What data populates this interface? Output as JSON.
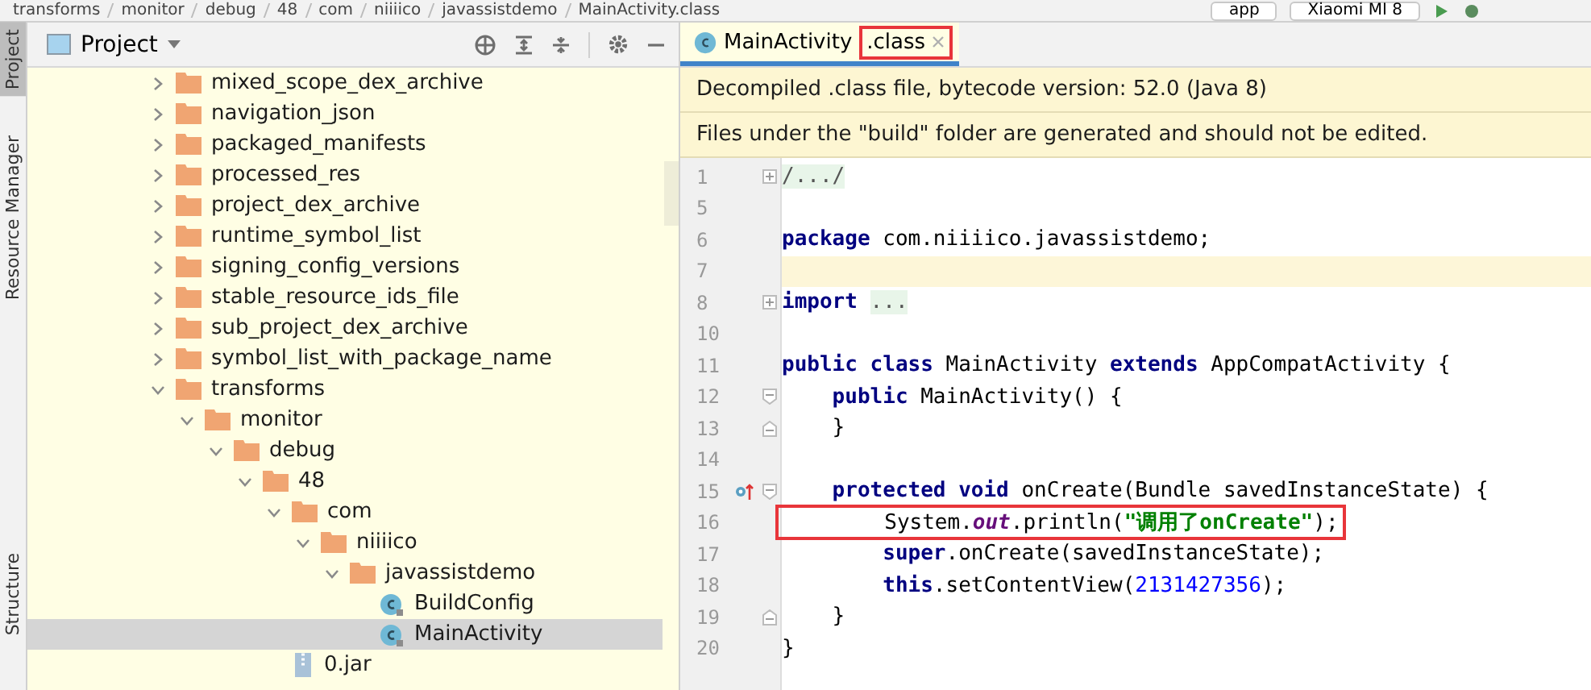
{
  "breadcrumbs": [
    "transforms",
    "monitor",
    "debug",
    "48",
    "com",
    "niiiico",
    "javassistdemo",
    "MainActivity.class"
  ],
  "run_config": {
    "module": "app",
    "device": "Xiaomi MI 8"
  },
  "tool_strip": [
    {
      "label": "Project",
      "selected": true
    },
    {
      "label": "Resource Manager",
      "selected": false
    },
    {
      "label": "Structure",
      "selected": false
    }
  ],
  "project_panel": {
    "title": "Project",
    "tree": [
      {
        "name": "mixed_scope_dex_archive",
        "kind": "folder",
        "expanded": false,
        "selected": false
      },
      {
        "name": "navigation_json",
        "kind": "folder",
        "expanded": false,
        "selected": false
      },
      {
        "name": "packaged_manifests",
        "kind": "folder",
        "expanded": false,
        "selected": false
      },
      {
        "name": "processed_res",
        "kind": "folder",
        "expanded": false,
        "selected": false
      },
      {
        "name": "project_dex_archive",
        "kind": "folder",
        "expanded": false,
        "selected": false
      },
      {
        "name": "runtime_symbol_list",
        "kind": "folder",
        "expanded": false,
        "selected": false
      },
      {
        "name": "signing_config_versions",
        "kind": "folder",
        "expanded": false,
        "selected": false
      },
      {
        "name": "stable_resource_ids_file",
        "kind": "folder",
        "expanded": false,
        "selected": false
      },
      {
        "name": "sub_project_dex_archive",
        "kind": "folder",
        "expanded": false,
        "selected": false
      },
      {
        "name": "symbol_list_with_package_name",
        "kind": "folder",
        "expanded": false,
        "selected": false
      },
      {
        "name": "transforms",
        "kind": "folder",
        "expanded": true,
        "selected": false,
        "children": [
          {
            "name": "monitor",
            "kind": "folder",
            "expanded": true,
            "selected": false,
            "children": [
              {
                "name": "debug",
                "kind": "folder",
                "expanded": true,
                "selected": false,
                "children": [
                  {
                    "name": "48",
                    "kind": "folder",
                    "expanded": true,
                    "selected": false,
                    "children": [
                      {
                        "name": "com",
                        "kind": "folder",
                        "expanded": true,
                        "selected": false,
                        "children": [
                          {
                            "name": "niiiico",
                            "kind": "folder",
                            "expanded": true,
                            "selected": false,
                            "children": [
                              {
                                "name": "javassistdemo",
                                "kind": "folder",
                                "expanded": true,
                                "selected": false,
                                "children": [
                                  {
                                    "name": "BuildConfig",
                                    "kind": "class",
                                    "selected": false
                                  },
                                  {
                                    "name": "MainActivity",
                                    "kind": "class",
                                    "selected": true
                                  }
                                ]
                              }
                            ]
                          }
                        ]
                      },
                      {
                        "name": "0.jar",
                        "kind": "jar",
                        "selected": false
                      }
                    ]
                  }
                ]
              }
            ]
          }
        ]
      }
    ]
  },
  "editor": {
    "tabs": [
      {
        "name": "MainActivity",
        "extension": ".class",
        "selected": true,
        "highlighted": true
      }
    ],
    "banners": [
      "Decompiled .class file, bytecode version: 52.0 (Java 8)",
      "Files under the \"build\" folder are generated and should not be edited."
    ],
    "lines": [
      {
        "number": "1",
        "marker": {
          "kind": "collapsed"
        },
        "current": false,
        "highlighted": false,
        "tokens": [
          {
            "kind": "folded",
            "text": "/.../"
          }
        ]
      },
      {
        "number": "5",
        "current": false
      },
      {
        "number": "6",
        "current": false,
        "highlighted": false,
        "tokens": [
          {
            "kind": "kw",
            "text": "package"
          },
          {
            "kind": "plain",
            "text": " com.niiiico.javassistdemo;"
          }
        ]
      },
      {
        "number": "7",
        "current": true
      },
      {
        "number": "8",
        "marker": {
          "kind": "collapsed"
        },
        "current": false,
        "highlighted": false,
        "tokens": [
          {
            "kind": "kw",
            "text": "import "
          },
          {
            "kind": "folded",
            "text": "..."
          }
        ]
      },
      {
        "number": "10",
        "current": false
      },
      {
        "number": "11",
        "current": false,
        "highlighted": false,
        "tokens": [
          {
            "kind": "kw",
            "text": "public class"
          },
          {
            "kind": "plain",
            "text": " MainActivity "
          },
          {
            "kind": "kw",
            "text": "extends"
          },
          {
            "kind": "plain",
            "text": " AppCompatActivity {"
          }
        ]
      },
      {
        "number": "12",
        "marker": {
          "kind": "open"
        },
        "current": false,
        "highlighted": false,
        "tokens": [
          {
            "kind": "kw",
            "text": "    public"
          },
          {
            "kind": "plain",
            "text": " MainActivity() {"
          }
        ]
      },
      {
        "number": "13",
        "marker": {
          "kind": "close"
        },
        "current": false,
        "highlighted": false,
        "tokens": [
          {
            "kind": "plain",
            "text": "    }"
          }
        ]
      },
      {
        "number": "14",
        "current": false
      },
      {
        "number": "15",
        "marker": {
          "kind": "open"
        },
        "override": true,
        "current": false,
        "highlighted": false,
        "tokens": [
          {
            "kind": "kw",
            "text": "    protected void"
          },
          {
            "kind": "plain",
            "text": " onCreate(Bundle savedInstanceState) {"
          }
        ]
      },
      {
        "number": "16",
        "current": false,
        "highlighted": true,
        "tokens": [
          {
            "kind": "plain",
            "text": "        System."
          },
          {
            "kind": "field",
            "text": "out"
          },
          {
            "kind": "plain",
            "text": ".println("
          },
          {
            "kind": "str",
            "text": "\"调用了onCreate\""
          },
          {
            "kind": "plain",
            "text": ");"
          }
        ]
      },
      {
        "number": "17",
        "current": false,
        "highlighted": false,
        "tokens": [
          {
            "kind": "kw",
            "text": "        super"
          },
          {
            "kind": "plain",
            "text": ".onCreate(savedInstanceState);"
          }
        ]
      },
      {
        "number": "18",
        "current": false,
        "highlighted": false,
        "tokens": [
          {
            "kind": "kw",
            "text": "        this"
          },
          {
            "kind": "plain",
            "text": ".setContentView("
          },
          {
            "kind": "num",
            "text": "2131427356"
          },
          {
            "kind": "plain",
            "text": ");"
          }
        ]
      },
      {
        "number": "19",
        "marker": {
          "kind": "close"
        },
        "current": false,
        "highlighted": false,
        "tokens": [
          {
            "kind": "plain",
            "text": "    }"
          }
        ]
      },
      {
        "number": "20",
        "current": false,
        "highlighted": false,
        "tokens": [
          {
            "kind": "plain",
            "text": "}"
          }
        ]
      }
    ]
  }
}
